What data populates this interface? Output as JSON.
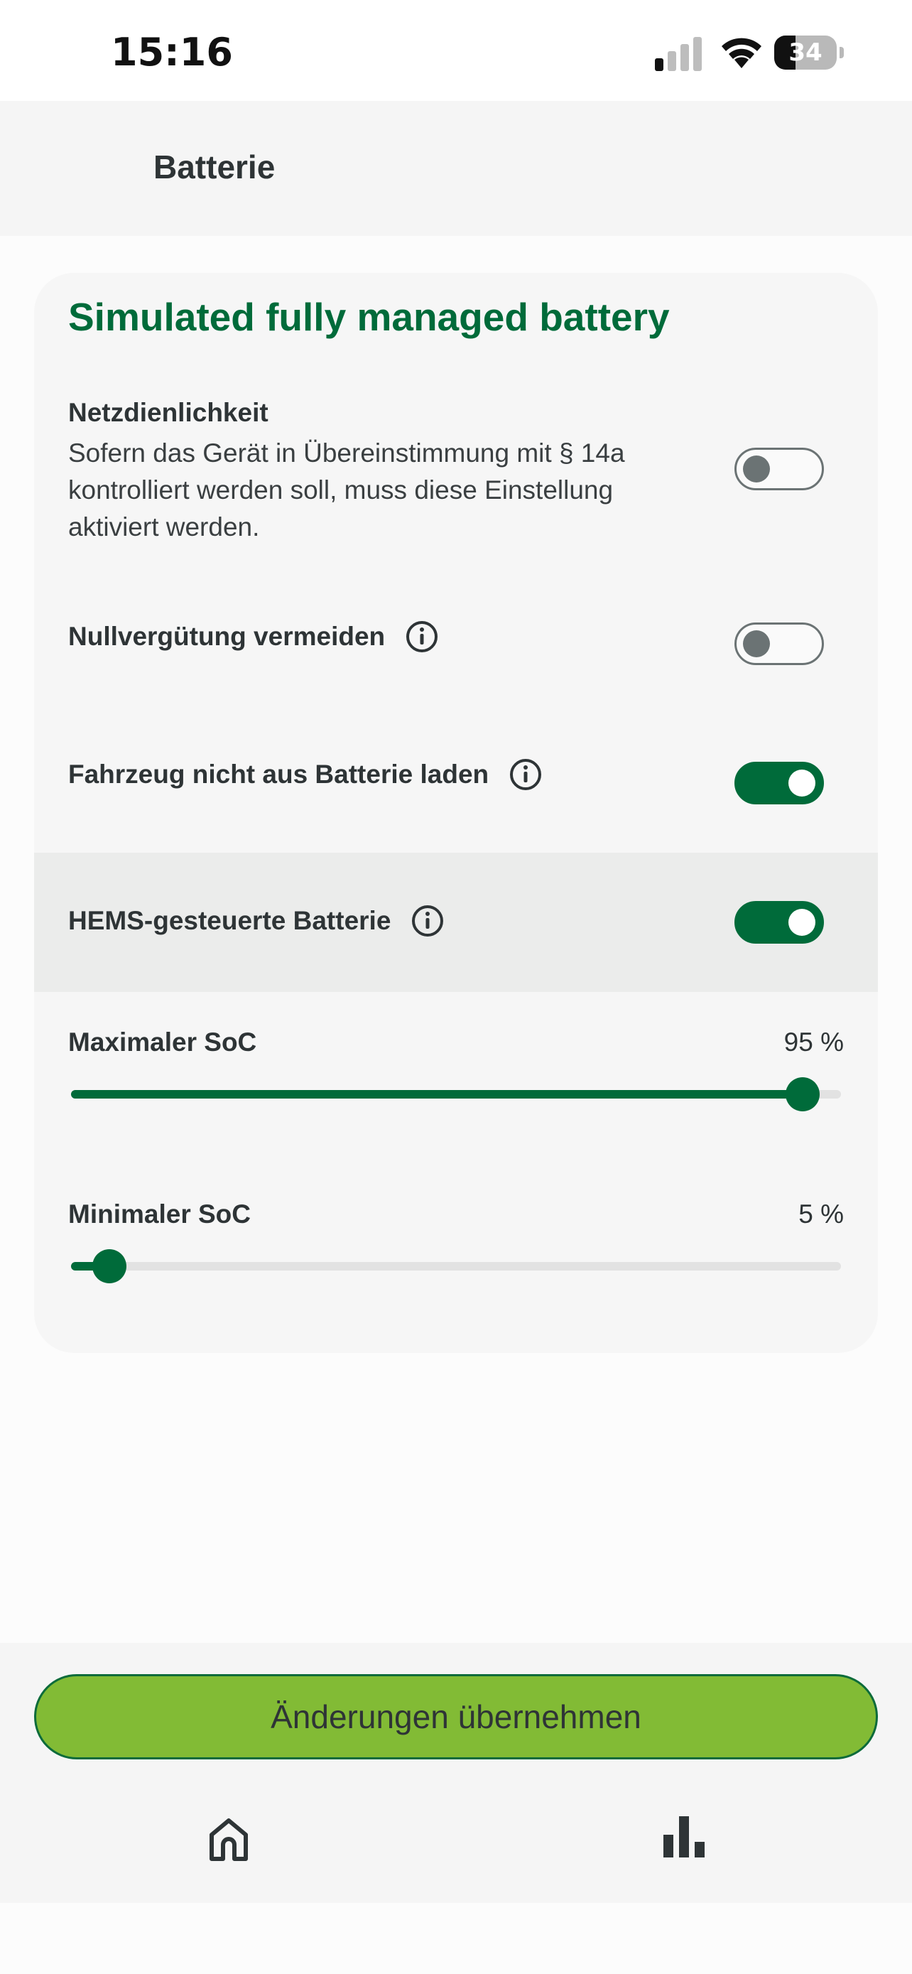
{
  "status_bar": {
    "time": "15:16",
    "battery_level": "34",
    "battery_fraction": 0.34,
    "icons": [
      "signal-icon",
      "wifi-icon",
      "battery-icon"
    ]
  },
  "header": {
    "title": "Batterie"
  },
  "card": {
    "title": "Simulated fully managed battery",
    "settings": [
      {
        "title": "Netzdienlichkeit",
        "description": "Sofern das Gerät in Übereinstimmung mit § 14a kontrolliert werden soll, muss diese Einstellung aktiviert werden.",
        "enabled": false
      },
      {
        "title": "Nullvergütung vermeiden",
        "info_icon": "info-icon",
        "enabled": false
      },
      {
        "title": "Fahrzeug nicht aus Batterie laden",
        "info_icon": "info-icon",
        "enabled": true
      },
      {
        "title": "HEMS-gesteuerte Batterie",
        "info_icon": "info-icon",
        "enabled": true
      }
    ],
    "sliders": [
      {
        "label": "Maximaler SoC",
        "value_text": "95 %",
        "value": 95
      },
      {
        "label": "Minimaler SoC",
        "value_text": "5 %",
        "value": 5
      }
    ]
  },
  "footer": {
    "apply_label": "Änderungen übernehmen",
    "nav": [
      {
        "icon": "home-icon"
      },
      {
        "icon": "bar-chart-icon"
      }
    ]
  },
  "colors": {
    "accent": "#006b3a",
    "button": "#82bb35",
    "toggle_off": "#6b7374"
  }
}
